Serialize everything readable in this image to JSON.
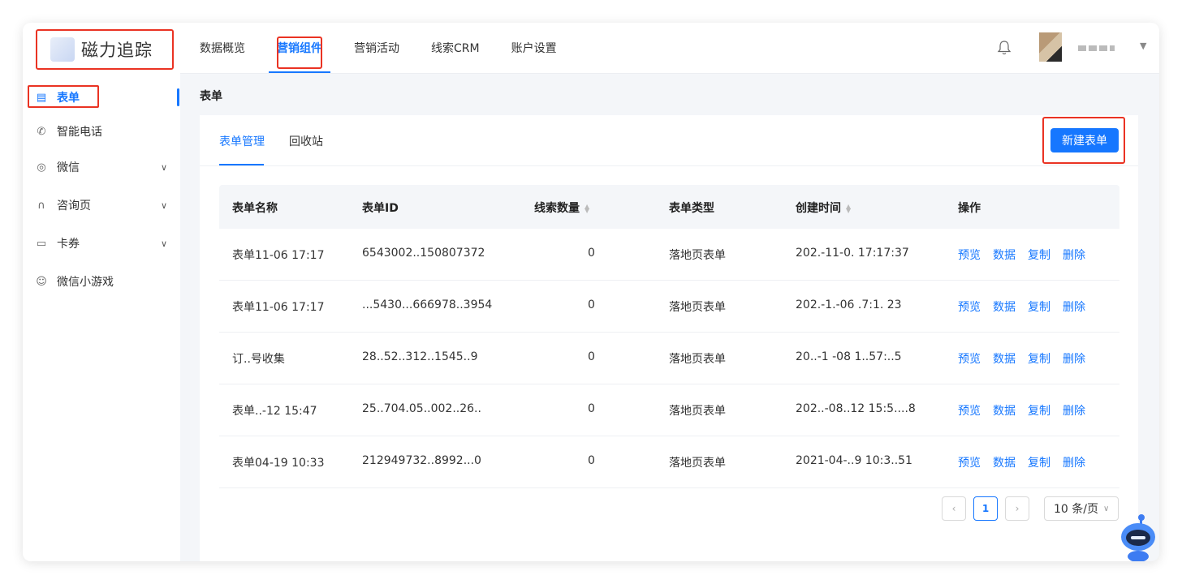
{
  "brand": {
    "name": "磁力追踪"
  },
  "nav": {
    "items": [
      {
        "label": "数据概览"
      },
      {
        "label": "营销组件"
      },
      {
        "label": "营销活动"
      },
      {
        "label": "线索CRM"
      },
      {
        "label": "账户设置"
      }
    ],
    "active": "营销组件"
  },
  "header": {
    "icons": [
      "bell-icon",
      "avatar",
      "chevron-down-icon"
    ]
  },
  "sidebar": {
    "items": [
      {
        "label": "表单",
        "icon": "form-icon",
        "expandable": false
      },
      {
        "label": "智能电话",
        "icon": "phone-icon",
        "expandable": false
      },
      {
        "label": "微信",
        "icon": "wechat-icon",
        "expandable": true
      },
      {
        "label": "咨询页",
        "icon": "headset-icon",
        "expandable": true
      },
      {
        "label": "卡券",
        "icon": "coupon-icon",
        "expandable": true
      },
      {
        "label": "微信小游戏",
        "icon": "gamepad-icon",
        "expandable": false
      }
    ],
    "active": "表单"
  },
  "page": {
    "title": "表单"
  },
  "tabs": {
    "items": [
      {
        "label": "表单管理"
      },
      {
        "label": "回收站"
      }
    ],
    "active": "表单管理"
  },
  "toolbar": {
    "new_label": "新建表单"
  },
  "table": {
    "columns": [
      "表单名称",
      "表单ID",
      "线索数量",
      "表单类型",
      "创建时间",
      "操作"
    ],
    "sortable": [
      "线索数量",
      "创建时间"
    ],
    "rows": [
      {
        "name": "表单11-06 17:17",
        "id": "6543002..150807372",
        "count": "0",
        "type": "落地页表单",
        "created": "202.-11-0. 17:17:37"
      },
      {
        "name": "表单11-06 17:17",
        "id": "...5430...666978..3954",
        "count": "0",
        "type": "落地页表单",
        "created": "202.-1.-06 .7:1. 23"
      },
      {
        "name": "订..号收集",
        "id": "28..52..312..1545..9",
        "count": "0",
        "type": "落地页表单",
        "created": "20..-1 -08 1..57:..5"
      },
      {
        "name": "表单..-12 15:47",
        "id": "25..704.05..002..26..",
        "count": "0",
        "type": "落地页表单",
        "created": "202..-08..12 15:5....8"
      },
      {
        "name": "表单04-19 10:33",
        "id": "212949732..8992...0",
        "count": "0",
        "type": "落地页表单",
        "created": "2021-04-..9 10:3..51"
      }
    ],
    "row_actions": [
      "预览",
      "数据",
      "复制",
      "删除"
    ]
  },
  "pagination": {
    "current_page": "1",
    "page_size": "10 条/页"
  },
  "colors": {
    "accent": "#1677ff",
    "highlight_box": "#ea3323",
    "background": "#f4f6f9"
  }
}
